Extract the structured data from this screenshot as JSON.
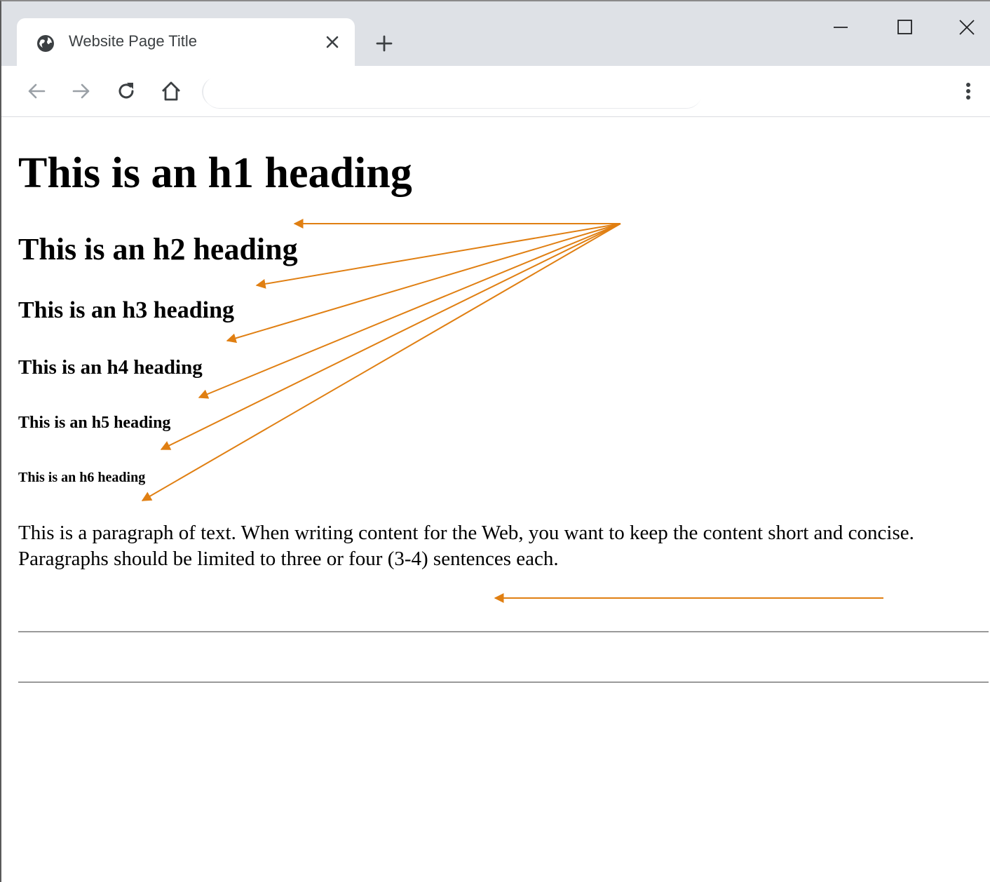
{
  "browser": {
    "tab_title": "Website Page Title",
    "address": ""
  },
  "page": {
    "h1": "This is an h1 heading",
    "h2": "This is an h2 heading",
    "h3": "This is an h3 heading",
    "h4": "This is an h4 heading",
    "h5": "This is an h5 heading",
    "h6": "This is an h6 heading",
    "paragraph": "This is a paragraph of text. When writing content for the Web, you want to keep the content short and concise. Paragraphs should be limited to three or four (3-4) sentences each."
  },
  "icons": {
    "favicon": "globe-icon",
    "tab_close": "close-icon",
    "new_tab": "plus-icon",
    "minimize": "minimize-icon",
    "maximize": "maximize-icon",
    "close_window": "close-icon",
    "back": "back-arrow-icon",
    "forward": "forward-arrow-icon",
    "reload": "reload-icon",
    "home": "home-icon",
    "menu": "vertical-dots-icon"
  },
  "colors": {
    "annotation_arrow": "#e07f12",
    "titlebar": "#dee1e6"
  }
}
